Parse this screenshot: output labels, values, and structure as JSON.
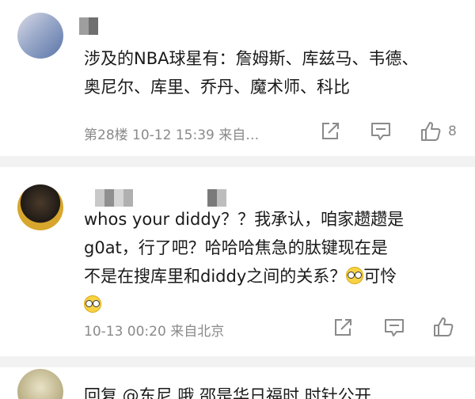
{
  "comments": [
    {
      "text_lines": [
        "涉及的NBA球星有：詹姆斯、库兹马、韦德、",
        "奥尼尔、库里、乔丹、魔术师、科比"
      ],
      "meta": "第28楼 10-12 15:39 来自…",
      "like_count": "8"
    },
    {
      "text_lines": [
        "whos your diddy？？我承认，咱家趱趱是",
        "g0at，行了吧？哈哈哈焦急的肽键现在是",
        "不是在搜库里和diddy之间的关系？"
      ],
      "emoji_text": "可怜",
      "meta": "10-13 00:20 来自北京"
    },
    {
      "partial_text": "回复 @东尼 哦 邵是华日福时 时针公开"
    }
  ],
  "icons": {
    "share": "share-icon",
    "comment": "comment-icon",
    "like": "thumbs-up-icon",
    "emoji": "emoji-pitiful-icon"
  },
  "colors": {
    "divider": "#f2f2f2",
    "meta_text": "#8a8a8a",
    "body_text": "#1a1a1a"
  }
}
